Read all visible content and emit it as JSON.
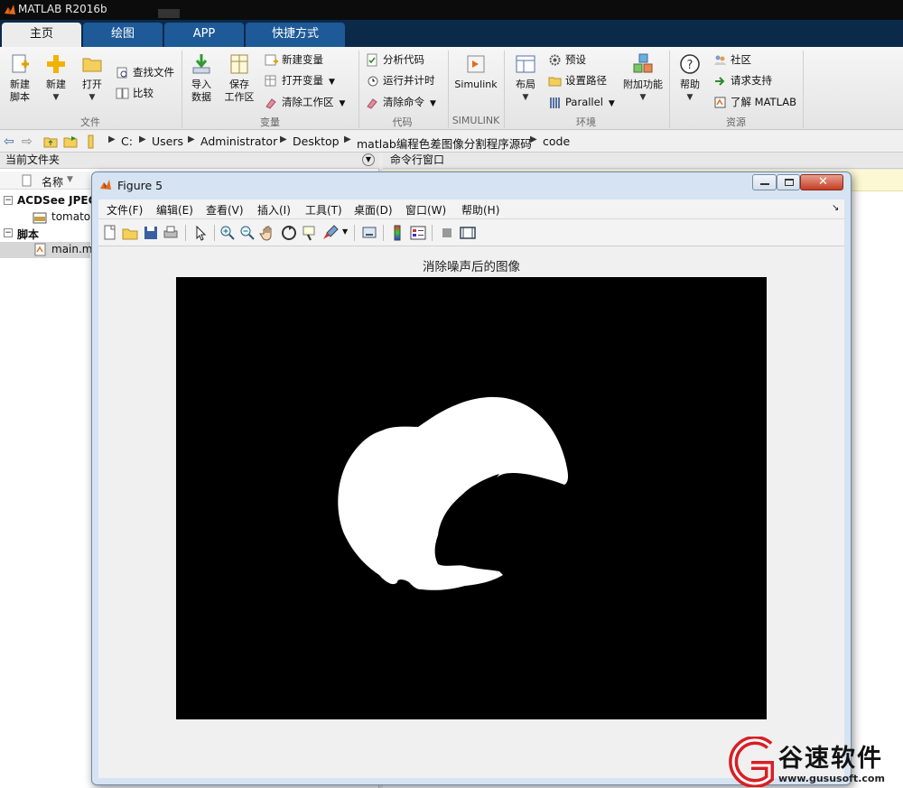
{
  "app": {
    "title": "MATLAB R2016b"
  },
  "tabs": [
    "主页",
    "绘图",
    "APP",
    "快捷方式"
  ],
  "ribbon": {
    "file": {
      "label": "文件",
      "new_script": "新建\n脚本",
      "new": "新建",
      "open": "打开",
      "find_files": "查找文件",
      "compare": "比较"
    },
    "variable": {
      "label": "变量",
      "import_data": "导入\n数据",
      "save_workspace": "保存\n工作区",
      "new_variable": "新建变量",
      "open_variable": "打开变量",
      "clear_workspace": "清除工作区"
    },
    "code": {
      "label": "代码",
      "analyze_code": "分析代码",
      "run_and_time": "运行并计时",
      "clear_commands": "清除命令"
    },
    "simulink": {
      "label": "SIMULINK",
      "simulink": "Simulink"
    },
    "environment": {
      "label": "环境",
      "layout": "布局",
      "preferences": "预设",
      "set_path": "设置路径",
      "parallel": "Parallel",
      "addons": "附加功能"
    },
    "resources": {
      "label": "资源",
      "help": "帮助",
      "community": "社区",
      "request_support": "请求支持",
      "learn_matlab": "了解 MATLAB"
    }
  },
  "address": {
    "crumbs": [
      "C:",
      "Users",
      "Administrator",
      "Desktop",
      "matlab编程色差图像分割程序源码",
      "code"
    ]
  },
  "current_folder": {
    "title": "当前文件夹",
    "column": "名称",
    "groups": [
      {
        "name": "ACDSee JPEG",
        "items": [
          "tomato"
        ]
      },
      {
        "name": "脚本",
        "items": [
          "main.m"
        ]
      }
    ]
  },
  "command_window": {
    "title": "命令行窗口"
  },
  "figure": {
    "title": "Figure 5",
    "menus": [
      "文件(F)",
      "编辑(E)",
      "查看(V)",
      "插入(I)",
      "工具(T)",
      "桌面(D)",
      "窗口(W)",
      "帮助(H)"
    ],
    "plot_title": "消除噪声后的图像"
  },
  "watermark": {
    "name": "谷速软件",
    "url": "www.gususoft.com"
  },
  "colors": {
    "tab_bar": "#0b2a4a",
    "tab": "#1d5a97",
    "accent": "#d81f26"
  }
}
